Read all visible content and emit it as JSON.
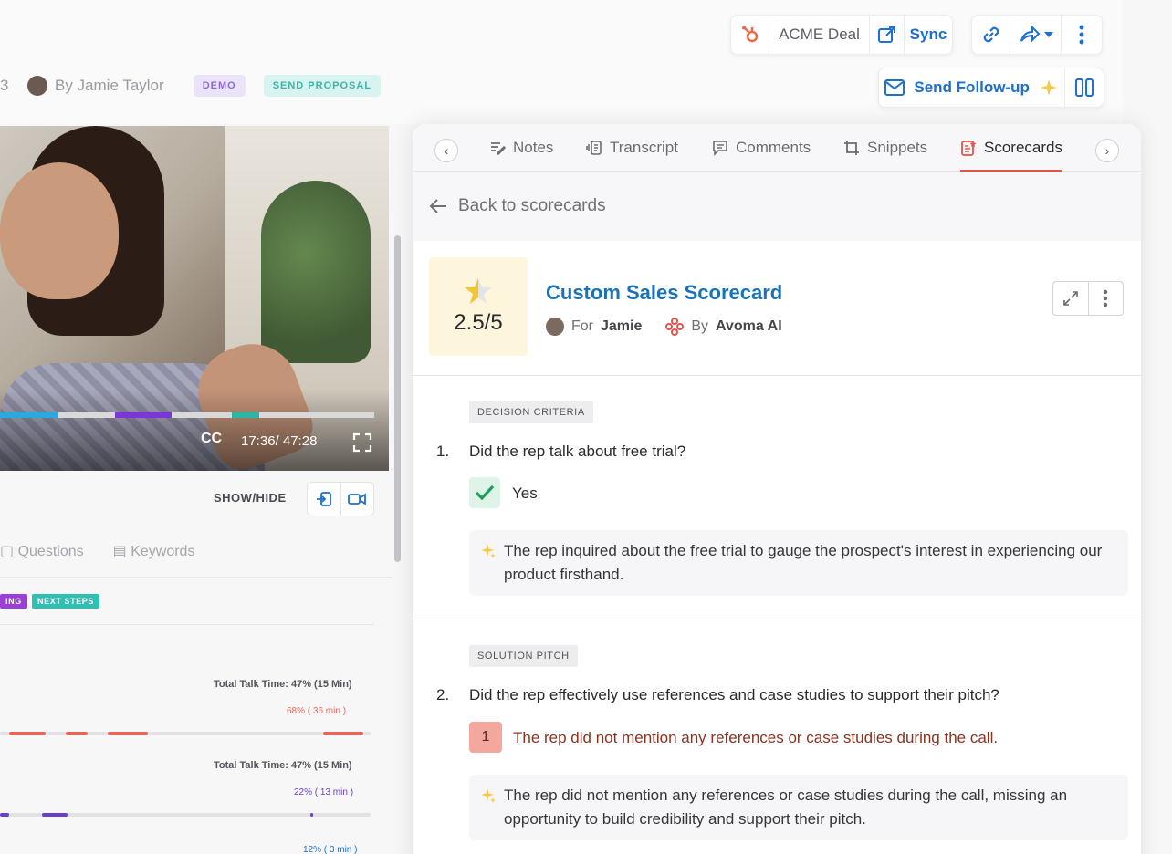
{
  "topbar": {
    "deal_label": "ACME Deal",
    "sync_label": "Sync",
    "follow_up_label": "Send Follow-up"
  },
  "meeting": {
    "number_fragment": "3",
    "by_label": "By Jamie Taylor",
    "tags": [
      "DEMO",
      "SEND PROPOSAL"
    ]
  },
  "video": {
    "cc_label": "CC",
    "time_label": "17:36/ 47:28",
    "show_hide_label": "SHOW/HIDE"
  },
  "left_tabs": [
    "Questions",
    "Keywords"
  ],
  "left_tags": [
    "ING",
    "NEXT STEPS"
  ],
  "talk_stats": [
    {
      "label": "Total Talk Time: 47% (15 Min)",
      "sub": "68%  ( 36 min )",
      "color": "#e8655c"
    },
    {
      "label": "Total Talk Time: 47% (15 Min)",
      "sub": "22%  ( 13 min )",
      "color": "#6a3fd0"
    },
    {
      "label": "",
      "sub": "12%  ( 3 min )",
      "color": "#1d6fd1"
    }
  ],
  "panel": {
    "tabs": [
      {
        "label": "Notes",
        "icon": "notes-icon"
      },
      {
        "label": "Transcript",
        "icon": "transcript-icon"
      },
      {
        "label": "Comments",
        "icon": "comments-icon"
      },
      {
        "label": "Snippets",
        "icon": "snippets-icon"
      },
      {
        "label": "Scorecards",
        "icon": "scorecards-icon",
        "active": true
      }
    ],
    "back_label": "Back to scorecards",
    "scorecard": {
      "score": "2.5/5",
      "title": "Custom Sales Scorecard",
      "for_prefix": "For",
      "for_name": "Jamie",
      "by_prefix": "By",
      "by_name": "Avoma AI"
    },
    "questions": [
      {
        "category": "DECISION CRITERIA",
        "number": "1.",
        "text": "Did the rep talk about free trial?",
        "answer": "Yes",
        "ai_note": "The rep inquired about the free trial to gauge the prospect's interest in experiencing our product firsthand."
      },
      {
        "category": "SOLUTION PITCH",
        "number": "2.",
        "text": "Did the rep effectively use references and case studies to support their pitch?",
        "answer_score": "1",
        "answer": "The rep did not mention any references or case studies during the call.",
        "ai_note": "The rep did not mention any references or case studies during the call, missing an opportunity to build credibility and support their pitch."
      }
    ]
  },
  "colors": {
    "accent_blue": "#1d6fd1",
    "active_tab_underline": "#e5534b",
    "score_bg": "#fdf6dc",
    "yes_bg": "#dff4e8",
    "score_low_bg": "#f3a79d"
  }
}
